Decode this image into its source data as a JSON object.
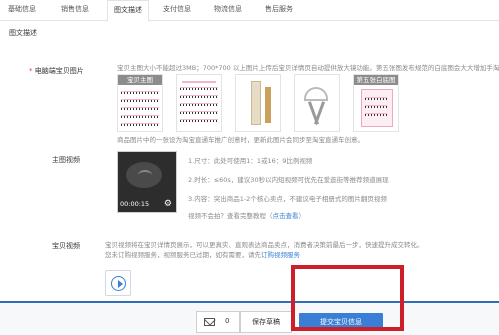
{
  "tabs": [
    "基础信息",
    "销售信息",
    "图文描述",
    "支付信息",
    "物流信息",
    "售后服务"
  ],
  "active_tab_index": 2,
  "section_title": "图文描述",
  "main_images": {
    "required_mark": "*",
    "label": "电脑端宝贝图片",
    "desc_top": "宝贝主图大小不能超过3MB；700*700 以上图片上传后宝贝详情页自动提供放大镜功能。第五张图发布规范的白底图会大大增加手淘曝",
    "thumb_captions": [
      "宝贝主图",
      "",
      "",
      "",
      "第五张白底图"
    ],
    "desc_bottom": "商品图片中的一张设为淘宝直通车推广创意时，更新此图片会同步至淘宝直通车创意。"
  },
  "main_video": {
    "label": "主图视频",
    "time": "00:00:15",
    "line1": "1.尺寸：此处可使用1：1或16：9比例视频",
    "line2": "2.时长：≤60s，建议30秒以内短视频可优先在爱逛街等推荐频道展现",
    "line3": "3.内容：突出商品1-2个核心卖点，不建议电子相册式的图片翻页视频",
    "line4_prefix": "视频不会拍？查看完整教程（",
    "line4_link": "点击查看",
    "line4_suffix": "）"
  },
  "item_video": {
    "label": "宝贝视频",
    "line1": "宝贝视频将在宝贝详情页展示，可以更真实、直观表达商品卖点，消费者决策前最后一步，快速提升成交转化。",
    "line2_prefix": "您未订购视频服务，视频服务已过期，如有需要，请先",
    "line2_link": "订购视频服务"
  },
  "bottom": {
    "draft_count": "0",
    "save_draft": "保存草稿",
    "submit": "提交宝贝信息"
  },
  "colors": {
    "accent": "#3a7fd5",
    "highlight": "#cc1f2a",
    "required": "#e4393c"
  }
}
